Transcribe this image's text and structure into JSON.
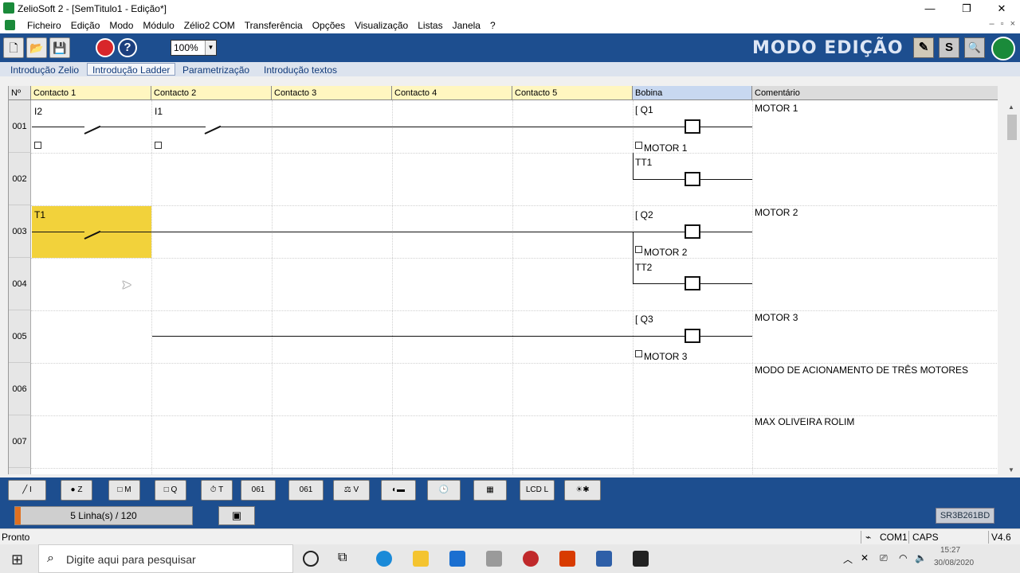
{
  "window": {
    "title": "ZelioSoft 2 - [SemTitulo1 - Edição*]",
    "min": "—",
    "restore": "❐",
    "close": "✕"
  },
  "menu": {
    "items": [
      "Ficheiro",
      "Edição",
      "Modo",
      "Módulo",
      "Zélio2 COM",
      "Transferência",
      "Opções",
      "Visualização",
      "Listas",
      "Janela",
      "?"
    ],
    "mdi": [
      "–",
      "▫",
      "×"
    ]
  },
  "toolbar": {
    "zoom": "100%",
    "mode_label": "MODO EDIÇÃO",
    "right_btns": [
      "✎",
      "S",
      "🔍"
    ]
  },
  "tabs": [
    "Introdução Zelio",
    "Introdução Ladder",
    "Parametrização",
    "Introdução textos"
  ],
  "grid": {
    "headers": [
      "Nº",
      "Contacto 1",
      "Contacto 2",
      "Contacto 3",
      "Contacto 4",
      "Contacto 5",
      "Bobina",
      "Comentário"
    ],
    "rows": [
      "001",
      "002",
      "003",
      "004",
      "005",
      "006",
      "007"
    ],
    "contacts": {
      "r1c1": "I2",
      "r1c2": "I1",
      "r3c1": "T1"
    },
    "coils": [
      {
        "name": "Q1",
        "sub": "MOTOR 1"
      },
      {
        "name": "TT1",
        "sub": ""
      },
      {
        "name": "Q2",
        "sub": "MOTOR 2"
      },
      {
        "name": "TT2",
        "sub": ""
      },
      {
        "name": "Q3",
        "sub": "MOTOR 3"
      }
    ],
    "comments": [
      "MOTOR 1",
      "MOTOR 2",
      "MOTOR 3",
      "MODO DE ACIONAMENTO DE TRÊS MOTORES",
      "MAX OLIVEIRA ROLIM"
    ]
  },
  "bottom_tools": [
    "I",
    "Z",
    "M",
    "Q",
    "T",
    "",
    "",
    "V",
    "",
    "",
    "",
    "L",
    ""
  ],
  "info": {
    "lines": "5 Linha(s) / 120",
    "ref": "SR3B261BD"
  },
  "status": {
    "ready": "Pronto",
    "com": "COM1",
    "caps": "CAPS",
    "version": "V4.6"
  },
  "taskbar": {
    "search_placeholder": "Digite aqui para pesquisar",
    "time": "15:27",
    "date": "30/08/2020"
  },
  "colors": {
    "toolbar_blue": "#1d4e8f",
    "highlight_yellow": "#f2d23b",
    "header_yellow": "#fff6c0",
    "bobina_blue": "#c8d8f0"
  }
}
